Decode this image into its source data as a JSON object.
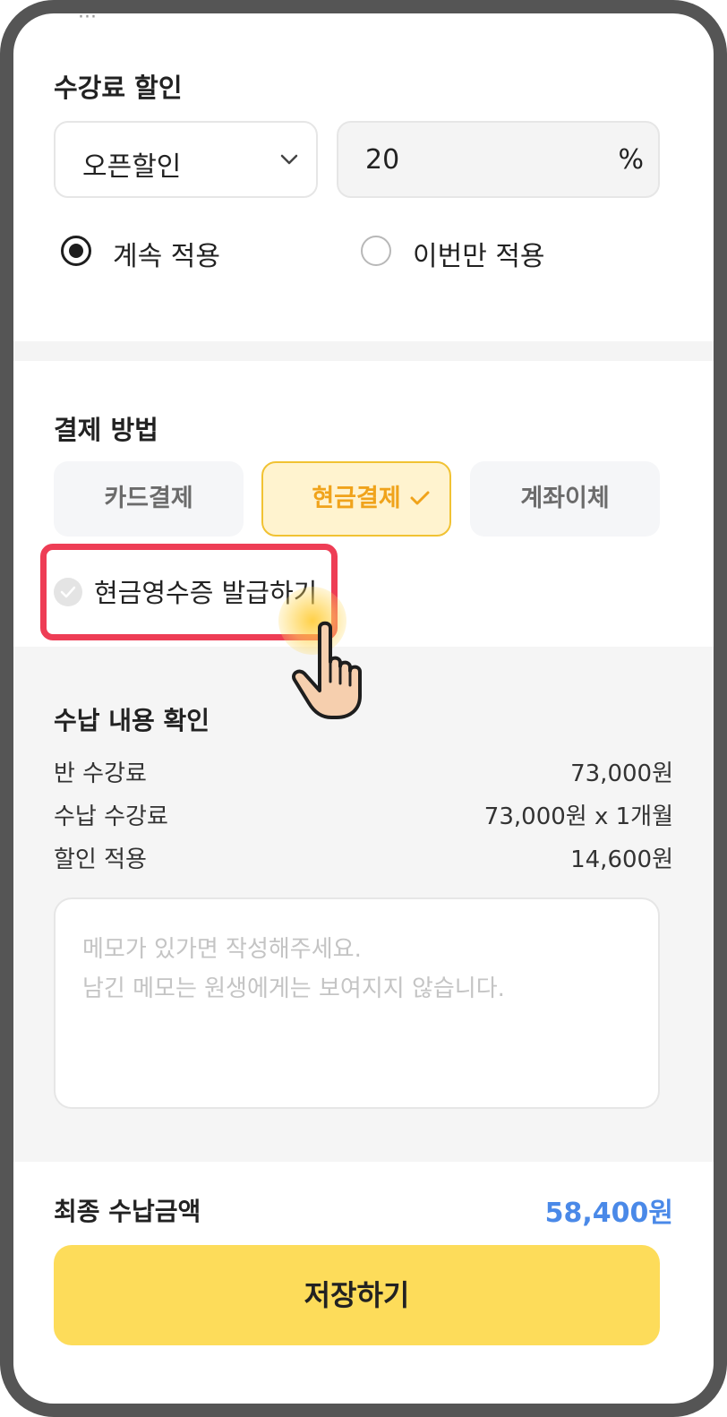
{
  "discount": {
    "title": "수강료 할인",
    "type_select": "오픈할인",
    "value": "20",
    "unit": "%",
    "options": [
      {
        "label": "계속 적용",
        "selected": true
      },
      {
        "label": "이번만 적용",
        "selected": false
      }
    ]
  },
  "payment": {
    "title": "결제 방법",
    "methods": [
      {
        "label": "카드결제",
        "selected": false
      },
      {
        "label": "현금결제",
        "selected": true
      },
      {
        "label": "계좌이체",
        "selected": false
      }
    ],
    "cash_receipt_label": "현금영수증 발급하기",
    "cash_receipt_checked": false
  },
  "summary": {
    "title": "수납 내용 확인",
    "rows": [
      {
        "label": "반 수강료",
        "value": "73,000원"
      },
      {
        "label": "수납 수강료",
        "value": "73,000원 x 1개월"
      },
      {
        "label": "할인 적용",
        "value": "14,600원"
      }
    ],
    "memo_placeholder": "메모가 있가면 작성해주세요.\n남긴 메모는 원생에게는 보여지지 않습니다."
  },
  "final": {
    "label": "최종 수납금액",
    "amount": "58,400원"
  },
  "save_label": "저장하기",
  "colors": {
    "accent_yellow": "#fddc5a",
    "selected_border": "#f1c233",
    "selected_text": "#f0a31b",
    "amount_blue": "#4a89e8",
    "highlight_red": "#ee3d55"
  }
}
